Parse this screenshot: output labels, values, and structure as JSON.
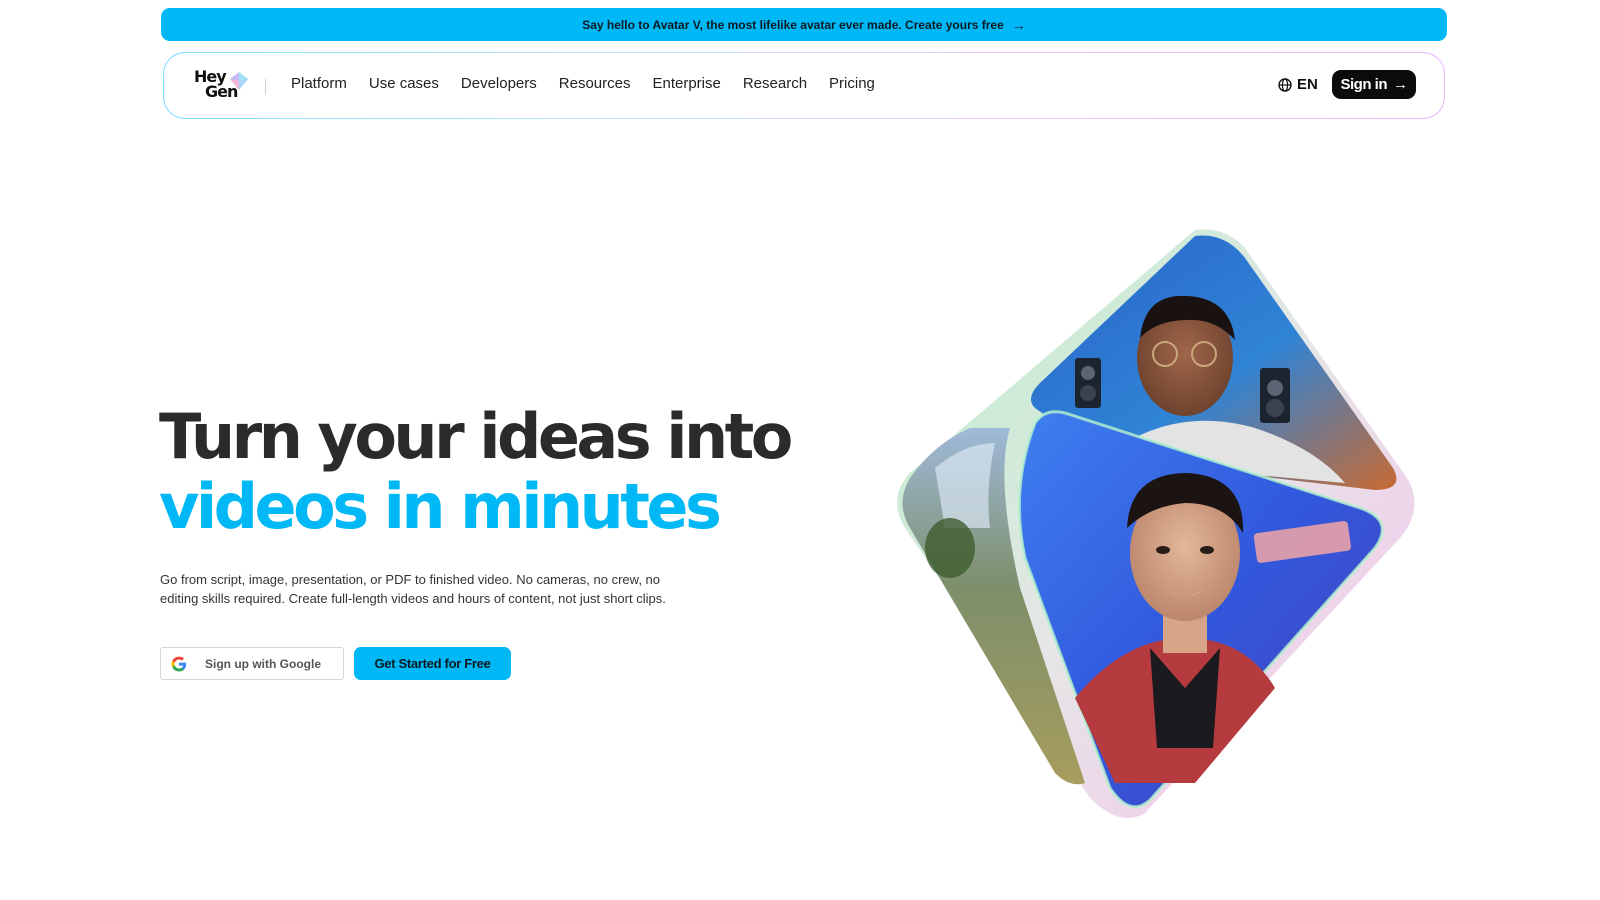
{
  "promo": {
    "text": "Say hello to Avatar V, the most lifelike avatar ever made. Create yours free",
    "icon": "arrow-right-icon"
  },
  "logo": {
    "line1": "Hey",
    "line2": "Gen"
  },
  "nav": {
    "links": [
      "Platform",
      "Use cases",
      "Developers",
      "Resources",
      "Enterprise",
      "Research",
      "Pricing"
    ],
    "language": "EN",
    "signin": "Sign in"
  },
  "hero": {
    "title_line1": "Turn your ideas into",
    "title_line2": "videos in minutes",
    "description": "Go from script, image, presentation, or PDF to finished video. No cameras, no crew, no editing skills required. Create full-length videos and hours of content, not just short clips.",
    "google_button": "Sign up with Google",
    "cta_button": "Get Started for Free"
  },
  "colors": {
    "accent": "#00b8f5",
    "dark": "#0b0b0b",
    "heading": "#2b2b2b"
  }
}
